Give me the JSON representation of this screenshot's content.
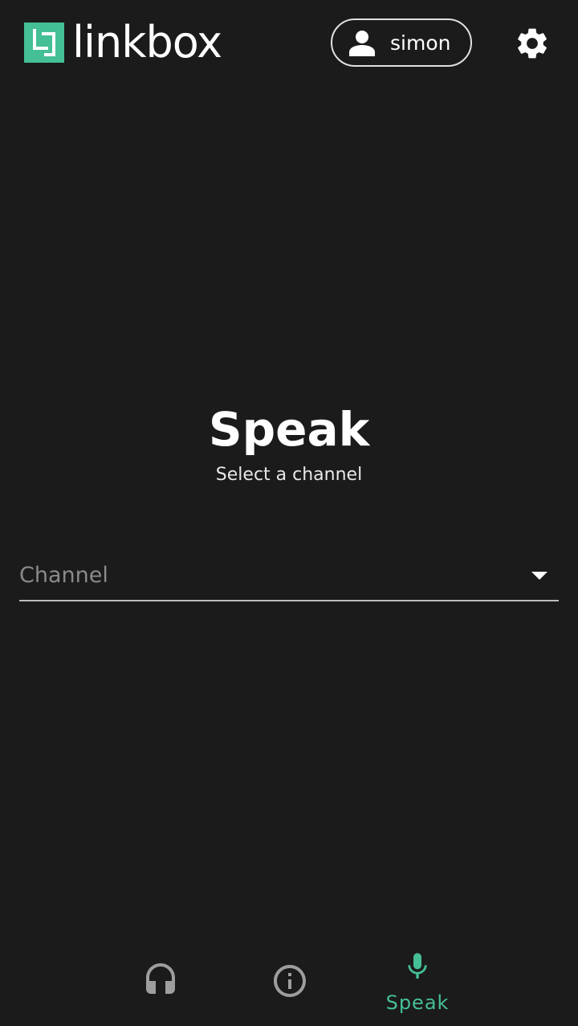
{
  "header": {
    "logo_text": "linkbox",
    "username": "simon"
  },
  "main": {
    "title": "Speak",
    "subtitle": "Select a channel",
    "channel_placeholder": "Channel"
  },
  "bottom_nav": {
    "items": [
      {
        "icon": "headphones-icon",
        "label": "",
        "active": false
      },
      {
        "icon": "info-icon",
        "label": "",
        "active": false
      },
      {
        "icon": "microphone-icon",
        "label": "Speak",
        "active": true
      }
    ]
  },
  "colors": {
    "background": "#1b1b1b",
    "accent": "#45bf96",
    "inactive_icon": "#9e9e9e"
  }
}
